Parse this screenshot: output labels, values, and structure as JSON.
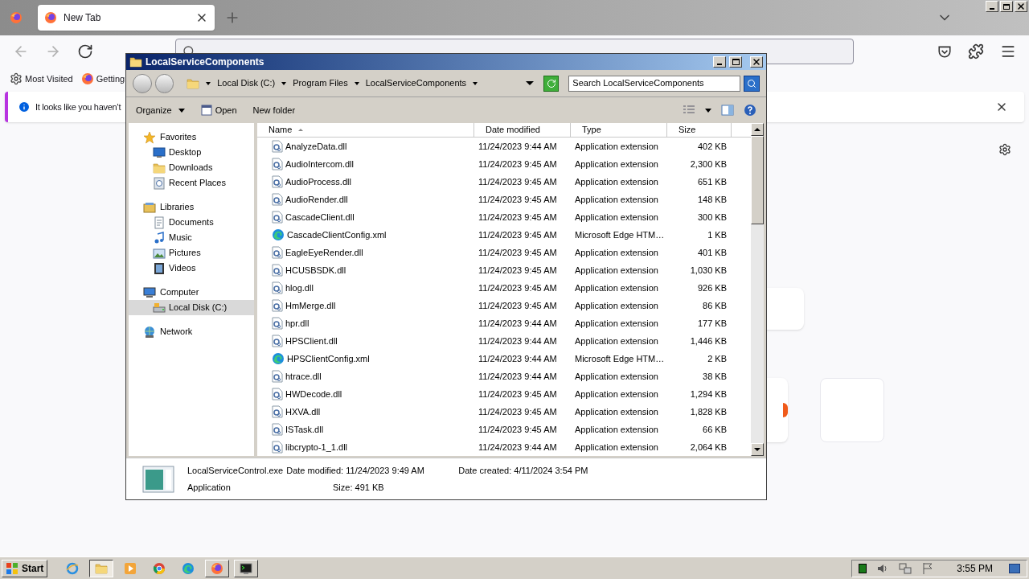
{
  "browser": {
    "tabs": [
      {
        "label": "New Tab",
        "selected": true
      }
    ],
    "bookmarks": [
      {
        "label": "Most Visited",
        "kind": "gear"
      },
      {
        "label": "Getting",
        "kind": "firefox"
      }
    ],
    "notice": "It looks like you haven’t"
  },
  "explorer": {
    "title": "LocalServiceComponents",
    "breadcrumb": [
      "Local Disk (C:)",
      "Program Files",
      "LocalServiceComponents"
    ],
    "search": {
      "placeholder": "Search LocalServiceComponents"
    },
    "toolbar": [
      "Organize",
      "Open",
      "New folder"
    ],
    "nav": [
      {
        "label": "Favorites",
        "kind": "star",
        "selected": false,
        "children": [
          {
            "label": "Desktop",
            "kind": "desktop",
            "selected": false
          },
          {
            "label": "Downloads",
            "kind": "folder",
            "selected": false
          },
          {
            "label": "Recent Places",
            "kind": "recent",
            "selected": false
          }
        ]
      },
      {
        "label": "Libraries",
        "kind": "library",
        "selected": false,
        "children": [
          {
            "label": "Documents",
            "kind": "doc",
            "selected": false
          },
          {
            "label": "Music",
            "kind": "music",
            "selected": false
          },
          {
            "label": "Pictures",
            "kind": "picture",
            "selected": false
          },
          {
            "label": "Videos",
            "kind": "video",
            "selected": false
          }
        ]
      },
      {
        "label": "Computer",
        "kind": "computer",
        "selected": false,
        "children": [
          {
            "label": "Local Disk (C:)",
            "kind": "disk",
            "selected": true
          }
        ]
      },
      {
        "label": "Network",
        "kind": "network",
        "selected": false
      }
    ],
    "columns": [
      "Name",
      "Date modified",
      "Type",
      "Size"
    ],
    "files": [
      {
        "name": "AnalyzeData.dll",
        "kind": "dll",
        "date": "11/24/2023 9:44 AM",
        "type": "Application extension",
        "size": "402 KB"
      },
      {
        "name": "AudioIntercom.dll",
        "kind": "dll",
        "date": "11/24/2023 9:45 AM",
        "type": "Application extension",
        "size": "2,300 KB"
      },
      {
        "name": "AudioProcess.dll",
        "kind": "dll",
        "date": "11/24/2023 9:45 AM",
        "type": "Application extension",
        "size": "651 KB"
      },
      {
        "name": "AudioRender.dll",
        "kind": "dll",
        "date": "11/24/2023 9:45 AM",
        "type": "Application extension",
        "size": "148 KB"
      },
      {
        "name": "CascadeClient.dll",
        "kind": "dll",
        "date": "11/24/2023 9:45 AM",
        "type": "Application extension",
        "size": "300 KB"
      },
      {
        "name": "CascadeClientConfig.xml",
        "kind": "edge",
        "date": "11/24/2023 9:45 AM",
        "type": "Microsoft Edge HTM…",
        "size": "1 KB"
      },
      {
        "name": "EagleEyeRender.dll",
        "kind": "dll",
        "date": "11/24/2023 9:45 AM",
        "type": "Application extension",
        "size": "401 KB"
      },
      {
        "name": "HCUSBSDK.dll",
        "kind": "dll",
        "date": "11/24/2023 9:45 AM",
        "type": "Application extension",
        "size": "1,030 KB"
      },
      {
        "name": "hlog.dll",
        "kind": "dll",
        "date": "11/24/2023 9:45 AM",
        "type": "Application extension",
        "size": "926 KB"
      },
      {
        "name": "HmMerge.dll",
        "kind": "dll",
        "date": "11/24/2023 9:45 AM",
        "type": "Application extension",
        "size": "86 KB"
      },
      {
        "name": "hpr.dll",
        "kind": "dll",
        "date": "11/24/2023 9:44 AM",
        "type": "Application extension",
        "size": "177 KB"
      },
      {
        "name": "HPSClient.dll",
        "kind": "dll",
        "date": "11/24/2023 9:44 AM",
        "type": "Application extension",
        "size": "1,446 KB"
      },
      {
        "name": "HPSClientConfig.xml",
        "kind": "edge",
        "date": "11/24/2023 9:44 AM",
        "type": "Microsoft Edge HTM…",
        "size": "2 KB"
      },
      {
        "name": "htrace.dll",
        "kind": "dll",
        "date": "11/24/2023 9:44 AM",
        "type": "Application extension",
        "size": "38 KB"
      },
      {
        "name": "HWDecode.dll",
        "kind": "dll",
        "date": "11/24/2023 9:45 AM",
        "type": "Application extension",
        "size": "1,294 KB"
      },
      {
        "name": "HXVA.dll",
        "kind": "dll",
        "date": "11/24/2023 9:45 AM",
        "type": "Application extension",
        "size": "1,828 KB"
      },
      {
        "name": "ISTask.dll",
        "kind": "dll",
        "date": "11/24/2023 9:45 AM",
        "type": "Application extension",
        "size": "66 KB"
      },
      {
        "name": "libcrypto-1_1.dll",
        "kind": "dll",
        "date": "11/24/2023 9:44 AM",
        "type": "Application extension",
        "size": "2,064 KB"
      }
    ],
    "details": {
      "name": "LocalServiceControl.exe",
      "type": "Application",
      "modified": "Date modified: 11/24/2023 9:49 AM",
      "size": "Size: 491 KB",
      "created": "Date created: 4/11/2024 3:54 PM"
    }
  },
  "taskbar": {
    "start": "Start",
    "apps": [
      {
        "kind": "ie",
        "selected": false,
        "open": false
      },
      {
        "kind": "explorer",
        "selected": true,
        "open": true
      },
      {
        "kind": "media",
        "selected": false,
        "open": false
      },
      {
        "kind": "chrome",
        "selected": false,
        "open": false
      },
      {
        "kind": "edge",
        "selected": false,
        "open": false
      },
      {
        "kind": "firefox",
        "selected": false,
        "open": true
      },
      {
        "kind": "terminal",
        "selected": false,
        "open": true
      }
    ],
    "clock": "3:55 PM"
  }
}
